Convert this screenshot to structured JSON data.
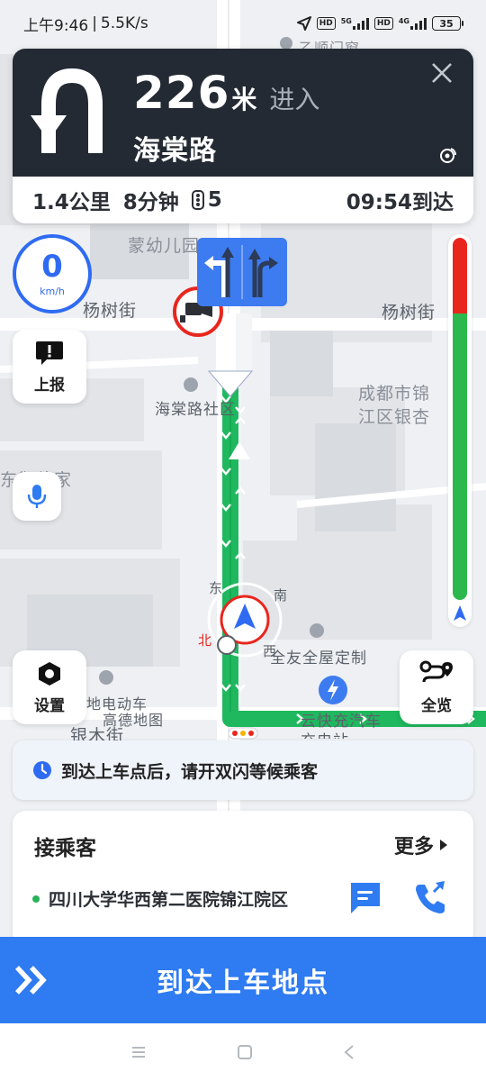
{
  "status_bar": {
    "time": "上午9:46",
    "net_speed": "5.5K/s",
    "hd1": "HD",
    "net1": "5G",
    "hd2": "HD",
    "net2": "4G",
    "battery": "35"
  },
  "navigation": {
    "turn_icon": "u-turn-icon",
    "distance": "226",
    "distance_unit": "米",
    "action": "进入",
    "road_name": "海棠路",
    "remaining_distance": "1.4公里",
    "remaining_time": "8分钟",
    "traffic_lights": "5",
    "arrival_time": "09:54到达"
  },
  "speed": {
    "value": "0",
    "unit": "km/h"
  },
  "controls": {
    "report_label": "上报",
    "settings_label": "设置",
    "overview_label": "全览"
  },
  "traffic_bar": {
    "congested_fraction": 0.21,
    "colors": {
      "congested": "#e8261e",
      "smooth": "#2db84d"
    }
  },
  "map_labels": {
    "top_poi": "乙顺门窗",
    "kindergarten": "蒙幼儿园",
    "street_left": "杨树街",
    "street_right": "杨树街",
    "community": "海棠路社区",
    "school": "成都市锦江区银杏小学",
    "furniture": "东御伦家",
    "poi_decor": "全友全屋定制",
    "poi_ev": "地电动车",
    "poi_amap": "高德地图",
    "street_bottom": "银木街",
    "poi_charge": "云快充汽车充电站",
    "compass_e": "东",
    "compass_s": "南",
    "compass_n": "北",
    "compass_w": "西"
  },
  "tip": {
    "text": "到达上车点后，请开双闪等候乘客"
  },
  "passenger": {
    "title": "接乘客",
    "more": "更多",
    "address": "四川大学华西第二医院锦江院区"
  },
  "arrive_button": {
    "label": "到达上车地点"
  },
  "colors": {
    "brand_blue": "#2f7bf1",
    "nav_dark": "#232a33",
    "route_green": "#1fb85e"
  }
}
